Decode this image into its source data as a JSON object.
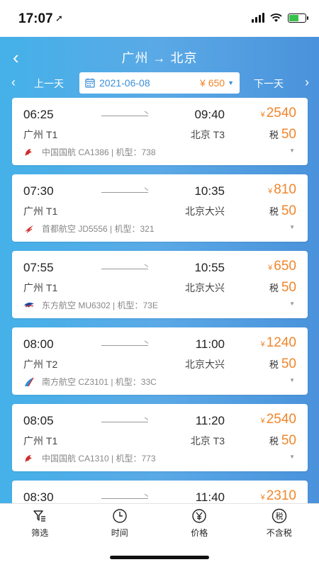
{
  "status_bar": {
    "time": "17:07"
  },
  "header": {
    "route": "广州 → 北京",
    "prev_day": "上一天",
    "next_day": "下一天",
    "date": "2021-06-08",
    "lowest_price": "¥ 650"
  },
  "colors": {
    "accent": "#4a9fe3",
    "price": "#f0862b"
  },
  "flights": [
    {
      "dep_time": "06:25",
      "arr_time": "09:40",
      "dep_airport": "广州 T1",
      "arr_airport": "北京 T3",
      "price": "2540",
      "tax": "50",
      "airline_info": "中国国航 CA1386 | 机型：738",
      "logo": "air-china-logo"
    },
    {
      "dep_time": "07:30",
      "arr_time": "10:35",
      "dep_airport": "广州 T1",
      "arr_airport": "北京大兴",
      "price": "810",
      "tax": "50",
      "airline_info": "首都航空 JD5556 | 机型：321",
      "logo": "capital-airlines-logo"
    },
    {
      "dep_time": "07:55",
      "arr_time": "10:55",
      "dep_airport": "广州 T1",
      "arr_airport": "北京大兴",
      "price": "650",
      "tax": "50",
      "airline_info": "东方航空 MU6302 | 机型：73E",
      "logo": "china-eastern-logo"
    },
    {
      "dep_time": "08:00",
      "arr_time": "11:00",
      "dep_airport": "广州 T2",
      "arr_airport": "北京大兴",
      "price": "1240",
      "tax": "50",
      "airline_info": "南方航空 CZ3101 | 机型：33C",
      "logo": "china-southern-logo"
    },
    {
      "dep_time": "08:05",
      "arr_time": "11:20",
      "dep_airport": "广州 T1",
      "arr_airport": "北京 T3",
      "price": "2540",
      "tax": "50",
      "airline_info": "中国国航 CA1310 | 机型：773",
      "logo": "air-china-logo"
    },
    {
      "dep_time": "08:30",
      "arr_time": "11:40",
      "price": "2310"
    }
  ],
  "labels": {
    "tax": "税",
    "yen": "¥"
  },
  "tabbar": [
    {
      "label": "筛选",
      "icon": "filter-icon"
    },
    {
      "label": "时间",
      "icon": "clock-icon"
    },
    {
      "label": "价格",
      "icon": "yen-circle-icon"
    },
    {
      "label": "不含税",
      "icon": "tax-circle-icon",
      "glyph": "税"
    }
  ]
}
